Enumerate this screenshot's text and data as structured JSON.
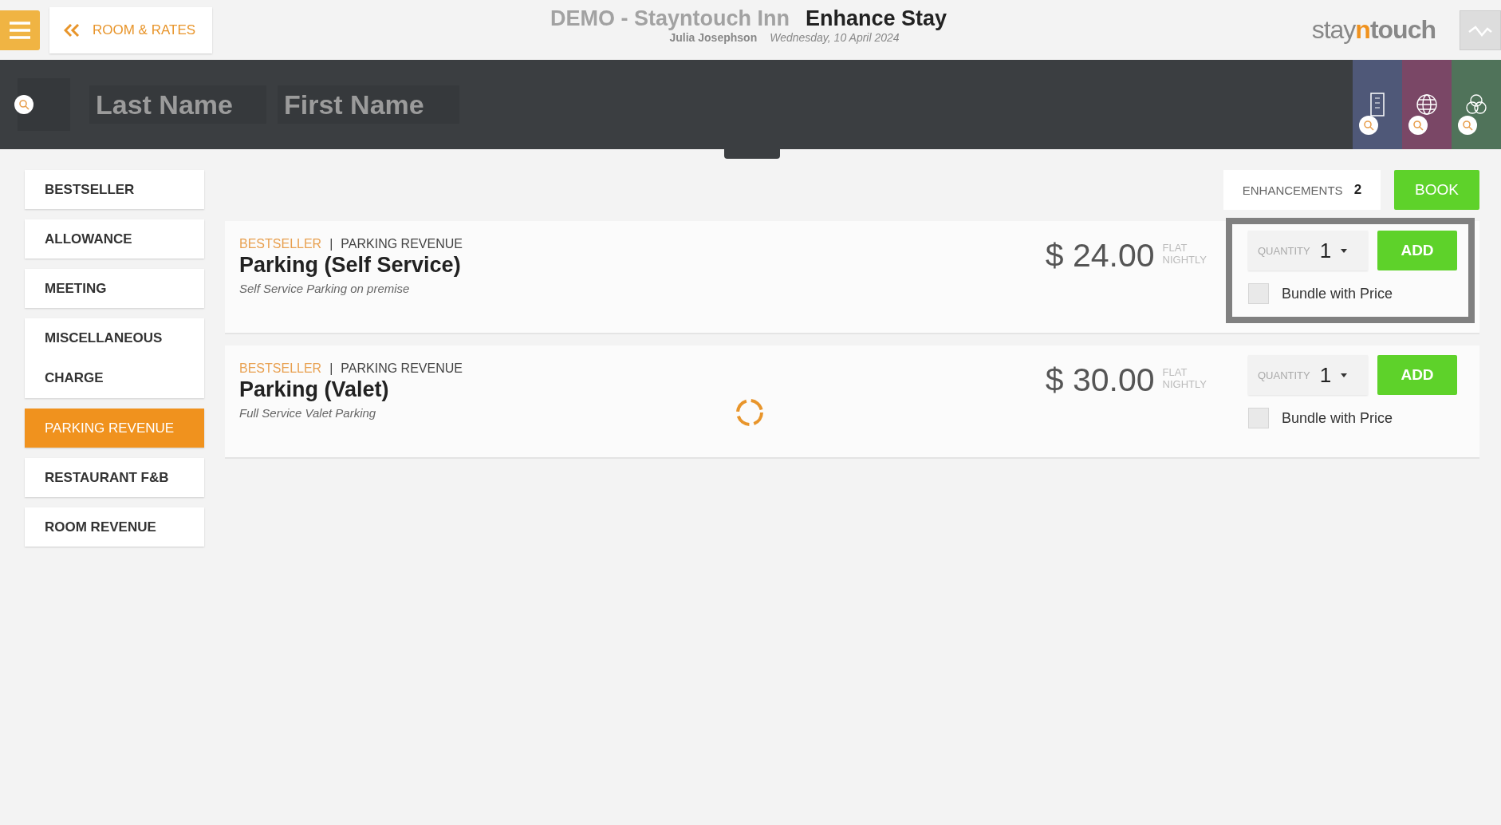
{
  "header": {
    "back_label": "ROOM & RATES",
    "hotel": "DEMO - Stayntouch Inn",
    "page_title": "Enhance Stay",
    "user": "Julia Josephson",
    "date": "Wednesday, 10 April 2024",
    "logo": [
      "stay",
      "n",
      "touch"
    ]
  },
  "search": {
    "last_name_placeholder": "Last Name",
    "first_name_placeholder": "First Name",
    "tabs": [
      {
        "kind": "building",
        "color": "#4f5878"
      },
      {
        "kind": "globe",
        "color": "#7a4766"
      },
      {
        "kind": "circles",
        "color": "#50735a"
      }
    ]
  },
  "sidebar": {
    "items": [
      {
        "label": "BESTSELLER",
        "selected": false
      },
      {
        "label": "ALLOWANCE",
        "selected": false
      },
      {
        "label": "MEETING",
        "selected": false
      },
      {
        "label": "MISCELLANEOUS CHARGE",
        "selected": false
      },
      {
        "label": "PARKING REVENUE",
        "selected": true
      },
      {
        "label": "RESTAURANT F&B",
        "selected": false
      },
      {
        "label": "ROOM REVENUE",
        "selected": false
      }
    ]
  },
  "toolbar": {
    "enhancements_label": "ENHANCEMENTS",
    "enhancements_count": "2",
    "book_label": "BOOK"
  },
  "loading": true,
  "addons": [
    {
      "tag": "BESTSELLER",
      "separator": "|",
      "category": "PARKING REVENUE",
      "name": "Parking (Self Service)",
      "description": "Self Service Parking on premise",
      "price": "$ 24.00",
      "price_type": "FLAT",
      "period": "NIGHTLY",
      "quantity_label": "QUANTITY",
      "quantity": "1",
      "add_label": "ADD",
      "bundle_label": "Bundle with Price",
      "bundled": false,
      "focused": true
    },
    {
      "tag": "BESTSELLER",
      "separator": "|",
      "category": "PARKING REVENUE",
      "name": "Parking (Valet)",
      "description": "Full Service Valet Parking",
      "price": "$ 30.00",
      "price_type": "FLAT",
      "period": "NIGHTLY",
      "quantity_label": "QUANTITY",
      "quantity": "1",
      "add_label": "ADD",
      "bundle_label": "Bundle with Price",
      "bundled": false,
      "focused": false
    }
  ]
}
